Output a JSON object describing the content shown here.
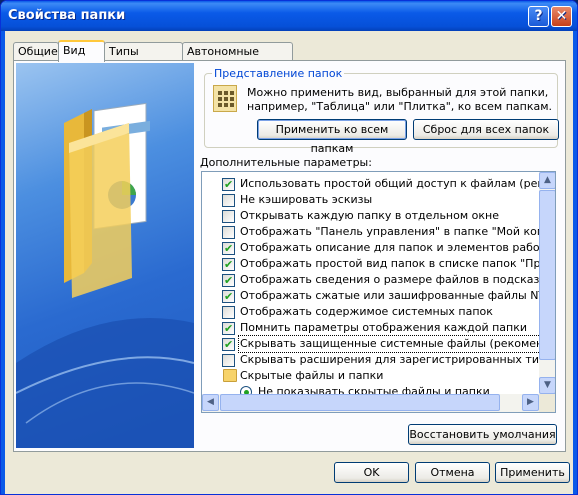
{
  "window": {
    "title": "Свойства папки"
  },
  "tabs": [
    {
      "label": "Общие"
    },
    {
      "label": "Вид"
    },
    {
      "label": "Типы файлов"
    },
    {
      "label": "Автономные файлы"
    }
  ],
  "folder_views": {
    "group_title": "Представление папок",
    "description": "Можно применить вид, выбранный для этой папки, например, \"Таблица\" или \"Плитка\", ко всем папкам.",
    "apply_all_label": "Применить ко всем папкам",
    "reset_all_label": "Сброс для всех папок"
  },
  "advanced": {
    "label": "Дополнительные параметры:",
    "items": [
      {
        "text": "Использовать простой общий доступ к файлам (рекомен",
        "checked": true
      },
      {
        "text": "Не кэшировать эскизы",
        "checked": false
      },
      {
        "text": "Открывать каждую папку в отдельном окне",
        "checked": false
      },
      {
        "text": "Отображать \"Панель управления\" в папке \"Мой компьют",
        "checked": false
      },
      {
        "text": "Отображать описание для папок и элементов рабочего с",
        "checked": true
      },
      {
        "text": "Отображать простой вид папок в списке папок \"Проводн",
        "checked": true
      },
      {
        "text": "Отображать сведения о размере файлов в подсказках па",
        "checked": true
      },
      {
        "text": "Отображать сжатые или зашифрованные файлы NTFS др",
        "checked": true
      },
      {
        "text": "Отображать содержимое системных папок",
        "checked": false
      },
      {
        "text": "Помнить параметры отображения каждой папки",
        "checked": true
      },
      {
        "text": "Скрывать защищенные системные файлы (рекомендуется)",
        "checked": true
      },
      {
        "text": "Скрывать расширения для зарегистрированных типов фай",
        "checked": false
      }
    ],
    "hidden_group": "Скрытые файлы и папки",
    "hidden_option": "Не показывать скрытые файлы и папки"
  },
  "restore_label": "Восстановить умолчания",
  "footer": {
    "ok_label": "OK",
    "cancel_label": "Отмена",
    "apply_label": "Применить"
  },
  "icons": [
    "help-icon",
    "close-icon",
    "folder-views-icon",
    "folder-icon",
    "scroll-up-icon",
    "scroll-down-icon",
    "scroll-left-icon",
    "scroll-right-icon"
  ],
  "colors": {
    "titlebar": "#0a5ae8",
    "group_title": "#0046d5",
    "check": "#21a121"
  }
}
